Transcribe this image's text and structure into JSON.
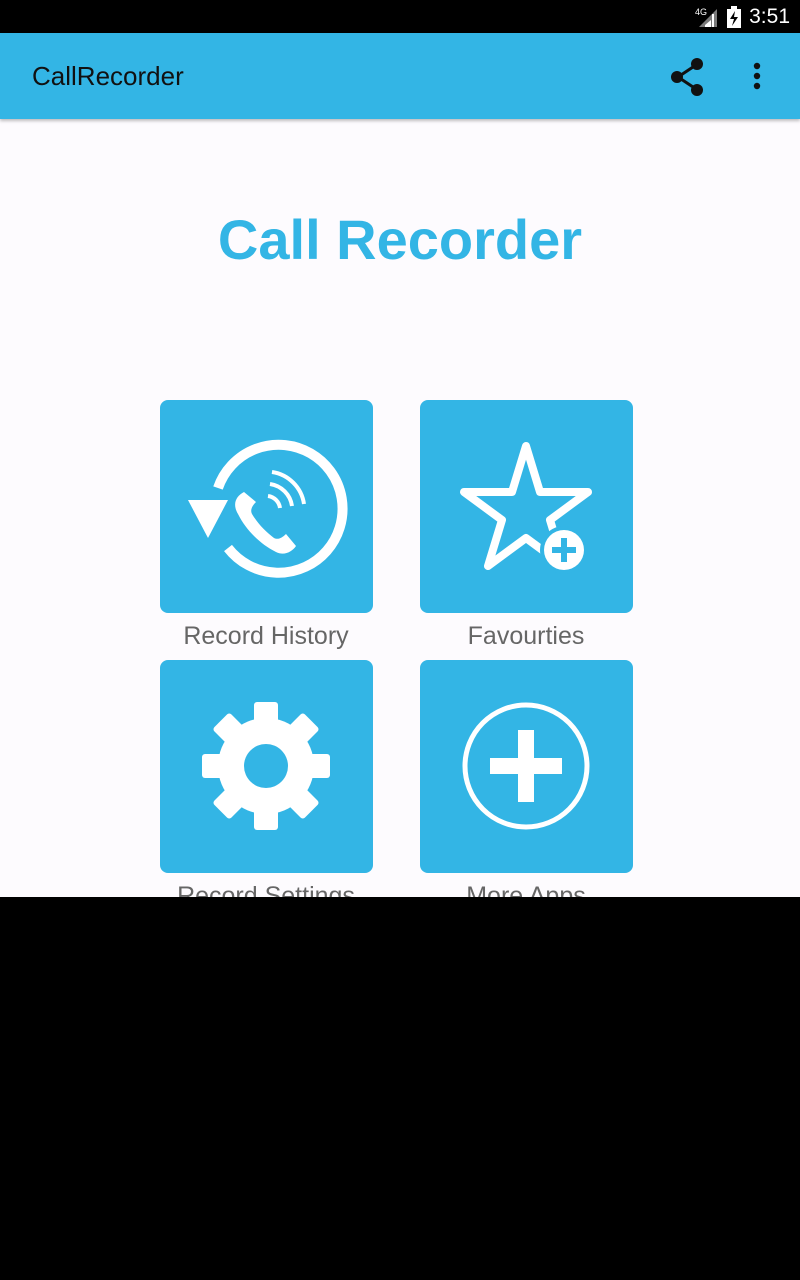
{
  "status_bar": {
    "time": "3:51",
    "network": "4G"
  },
  "app_bar": {
    "title": "CallRecorder",
    "share_icon": "share-icon",
    "overflow_icon": "more-vert-icon",
    "color": "#33b5e5"
  },
  "hero": {
    "title": "Call Recorder",
    "color": "#33b5e5"
  },
  "tiles": [
    {
      "label": "Record History",
      "icon": "call-history-icon"
    },
    {
      "label": "Favourties",
      "icon": "star-add-icon"
    },
    {
      "label": "Record Settings",
      "icon": "gear-icon"
    },
    {
      "label": "More Apps",
      "icon": "plus-circle-icon"
    }
  ]
}
